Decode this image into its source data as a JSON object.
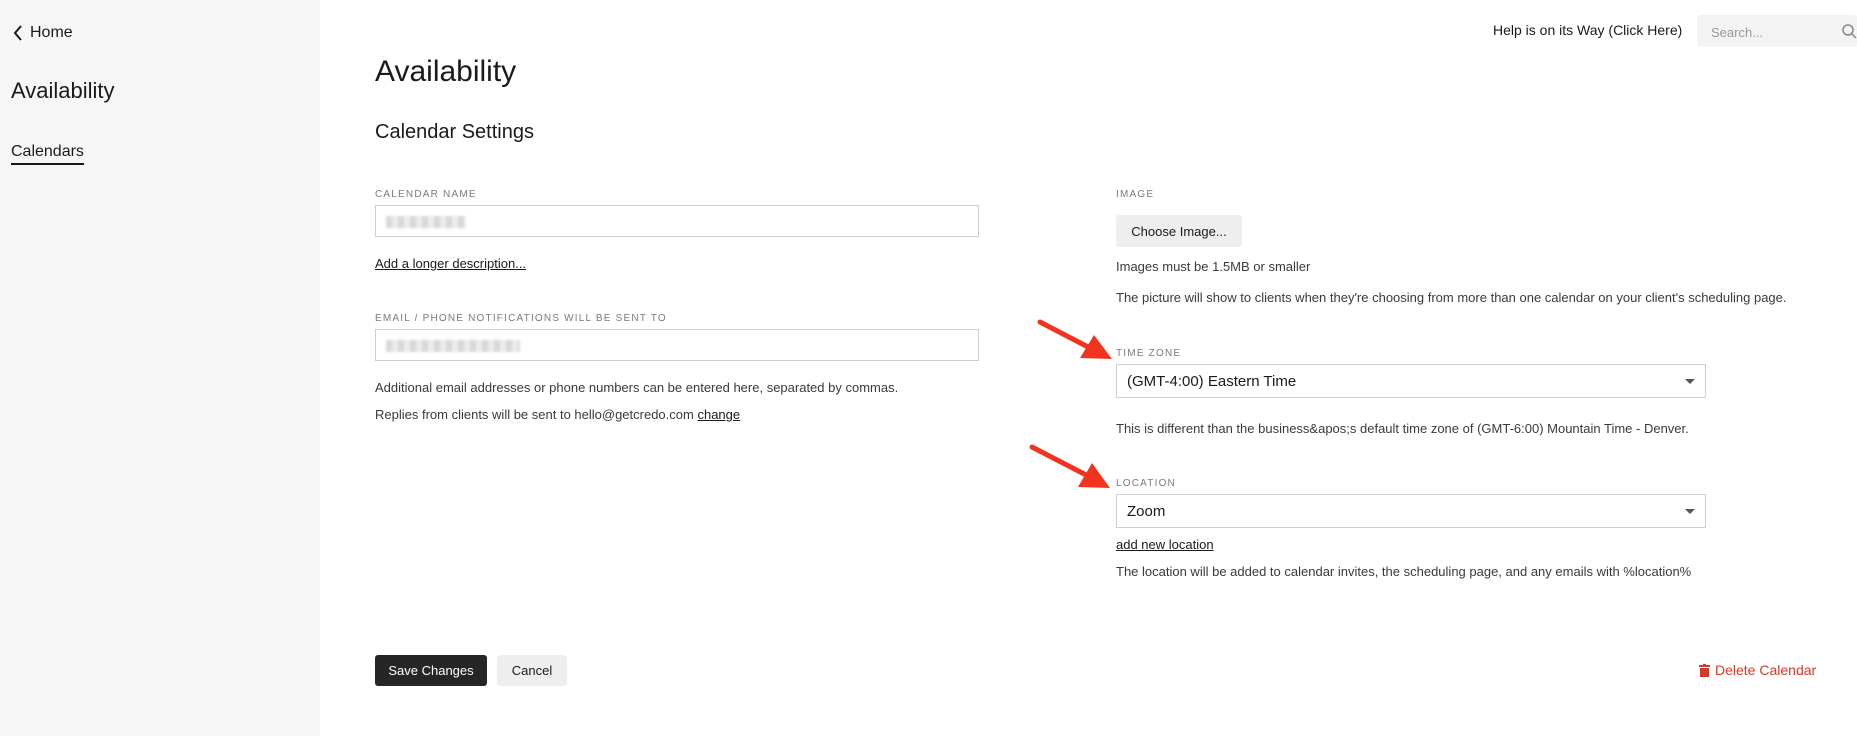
{
  "sidebar": {
    "home_label": "Home",
    "title": "Availability",
    "items": [
      {
        "label": "Calendars"
      }
    ]
  },
  "header": {
    "help_label": "Help is on its Way (Click Here)",
    "search_placeholder": "Search..."
  },
  "main": {
    "title": "Availability",
    "section_title": "Calendar Settings",
    "calendar_name": {
      "label": "CALENDAR NAME",
      "value": ""
    },
    "longer_description_link": "Add a longer description...",
    "notifications": {
      "label": "EMAIL / PHONE NOTIFICATIONS WILL BE SENT TO",
      "value": "",
      "help": "Additional email addresses or phone numbers can be entered here, separated by commas.",
      "replies_text": "Replies from clients will be sent to hello@getcredo.com",
      "change_link": "change"
    },
    "image": {
      "label": "IMAGE",
      "button_label": "Choose Image...",
      "size_note": "Images must be 1.5MB or smaller",
      "description": "The picture will show to clients when they're choosing from more than one calendar on your client's scheduling page."
    },
    "time_zone": {
      "label": "TIME ZONE",
      "selected": "(GMT-4:00) Eastern Time",
      "note": "This is different than the business&apos;s default time zone of (GMT-6:00) Mountain Time - Denver."
    },
    "location": {
      "label": "LOCATION",
      "selected": "Zoom",
      "add_link": "add new location",
      "note": "The location will be added to calendar invites, the scheduling page, and any emails with %location%"
    },
    "actions": {
      "save_label": "Save Changes",
      "cancel_label": "Cancel",
      "delete_label": "Delete Calendar"
    }
  },
  "colors": {
    "sidebar_bg": "#f6f6f6",
    "primary_button": "#262626",
    "danger": "#d23a2b",
    "annotation_arrow": "#f2331f"
  },
  "icons": [
    "chevron-left-icon",
    "search-icon",
    "chevron-down-icon",
    "trash-icon",
    "annotation-arrow"
  ]
}
